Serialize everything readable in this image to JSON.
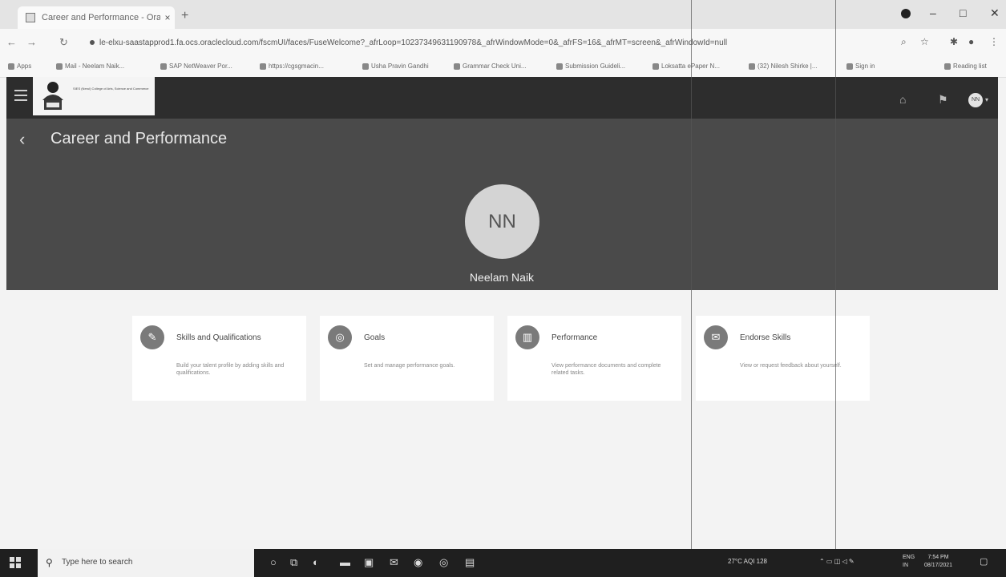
{
  "browser": {
    "tab_title": "Career and Performance - Oracl",
    "tab_close": "×",
    "new_tab": "+",
    "url": "le-elxu-saastapprod1.fa.ocs.oraclecloud.com/fscmUI/faces/FuseWelcome?_afrLoop=10237349631190978&_afrWindowMode=0&_afrFS=16&_afrMT=screen&_afrWindowId=null",
    "bookmarks": [
      "Apps",
      "Mail - Neelam Naik...",
      "SAP NetWeaver Por...",
      "https://cgsgmacin...",
      "Usha Pravin Gandhi",
      "Grammar Check Uni...",
      "Submission Guideli...",
      "Loksatta ePaper N...",
      "(32) Nilesh Shirke |...",
      "Sign in"
    ],
    "reading_list": "Reading list",
    "win_min": "–",
    "win_max": "□",
    "win_close": "✕"
  },
  "header": {
    "logo_text": "SIES (Nerul) College of Arts, Science and Commerce"
  },
  "banner": {
    "back_glyph": "‹",
    "page_title": "Career and Performance",
    "avatar_initials": "NN",
    "user_name": "Neelam Naik",
    "header_avatar": "NN"
  },
  "cards": [
    {
      "title": "Skills and Qualifications",
      "desc": "Build your talent profile by adding skills and qualifications.",
      "icon": "skills-icon",
      "glyph": "✎"
    },
    {
      "title": "Goals",
      "desc": "Set and manage performance goals.",
      "icon": "goals-icon",
      "glyph": "◎"
    },
    {
      "title": "Performance",
      "desc": "View performance documents and complete related tasks.",
      "icon": "performance-icon",
      "glyph": "▥"
    },
    {
      "title": "Endorse Skills",
      "desc": "View or request feedback about yourself.",
      "icon": "endorse-icon",
      "glyph": "✉"
    }
  ],
  "taskbar": {
    "search_placeholder": "Type here to search",
    "weather": "27°C  AQI 128",
    "lang": "ENG\nIN",
    "time": "7:54 PM",
    "date": "08/17/2021"
  },
  "colors": {
    "header_bg": "#2d2d2d",
    "banner_bg": "#4a4a4a",
    "page_bg": "#f3f3f3",
    "card_bg": "#ffffff"
  }
}
